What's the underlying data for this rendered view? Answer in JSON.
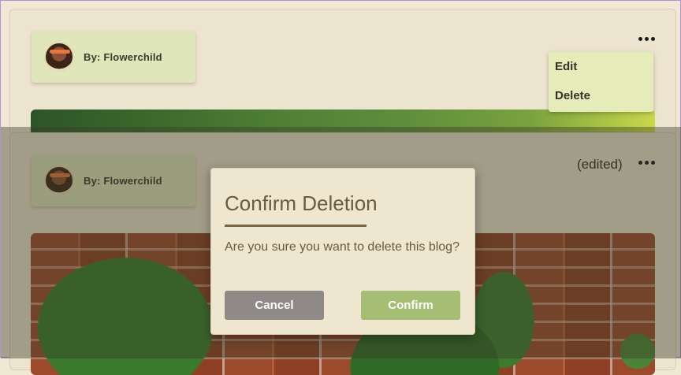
{
  "top_post": {
    "author": "By: Flowerchild",
    "menu": {
      "edit_label": "Edit",
      "delete_label": "Delete"
    }
  },
  "bottom_post": {
    "author": "By: Flowerchild",
    "edited_label": "(edited)"
  },
  "dialog": {
    "title": "Confirm Deletion",
    "message": "Are you sure you want to delete this blog?",
    "cancel_label": "Cancel",
    "confirm_label": "Confirm"
  },
  "colors": {
    "author_bg": "#dfe6b9",
    "cancel": "#8f8a87",
    "confirm": "#a6bd74",
    "title": "#6b5a3c"
  },
  "icons": {
    "more": "more-horizontal-icon",
    "avatar": "user-avatar"
  }
}
